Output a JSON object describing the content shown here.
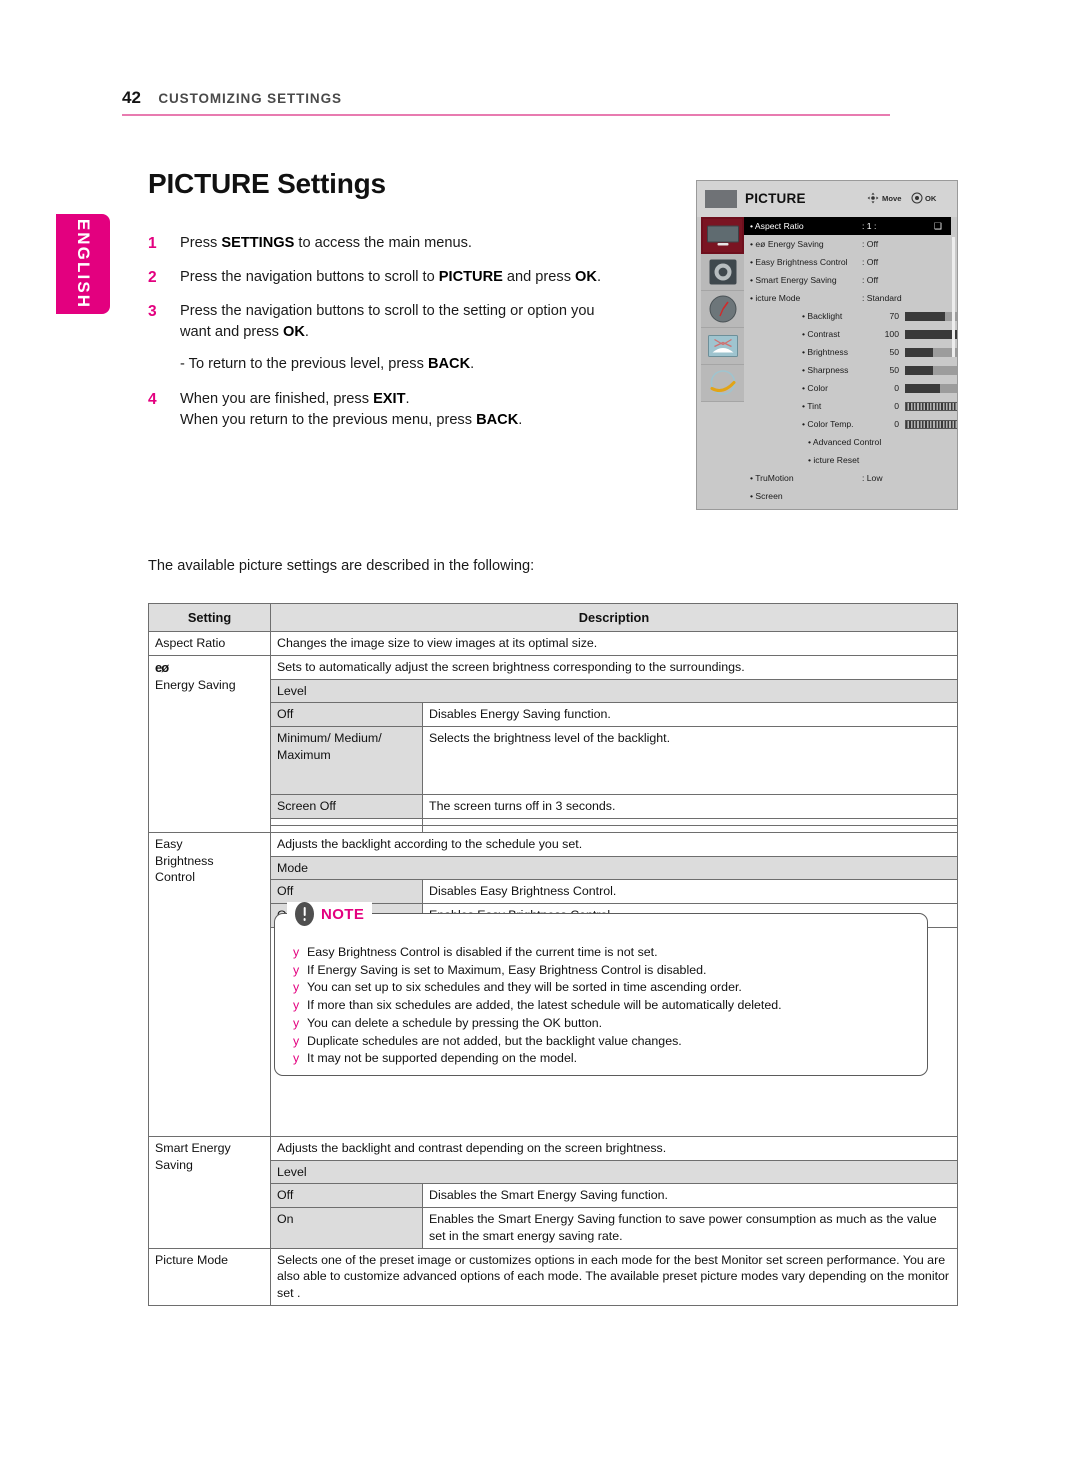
{
  "header": {
    "page_number": "42",
    "section": "CUSTOMIZING SETTINGS"
  },
  "language_tab": {
    "label": "ENGLISH"
  },
  "title": "PICTURE Settings",
  "steps": [
    {
      "num": "1",
      "html": "Press <b>SETTINGS</b> to access the main menus."
    },
    {
      "num": "2",
      "html": "Press the navigation buttons to scroll to <b>PICTURE</b> and press <b>OK</b>."
    },
    {
      "num": "3",
      "html": "Press the navigation buttons to scroll to the setting or option you want and press <b>OK</b>.",
      "sub": "- To return to the previous level, press <b>BACK</b>."
    },
    {
      "num": "4",
      "html": "When you are finished, press <b>EXIT</b>.<br>When you return to the previous menu, press <b>BACK</b>."
    }
  ],
  "intro_line": "The available picture settings are described in the following:",
  "osd": {
    "title": "PICTURE",
    "hint_move": "Move",
    "hint_ok": "OK",
    "rail_icons": [
      "monitor-icon",
      "speaker-icon",
      "clock-icon",
      "screen-icon",
      "globe-icon"
    ],
    "rows": [
      {
        "label": "• Aspect Ratio",
        "value": ": 1   :",
        "arrow": "❑",
        "highlight": true
      },
      {
        "label": "• eø Energy Saving",
        "value": ": Off"
      },
      {
        "label": "• Easy Brightness Control",
        "value": ": Off"
      },
      {
        "label": "• Smart Energy Saving",
        "value": ": Off"
      },
      {
        "label": "•    icture Mode",
        "value": ": Standard"
      }
    ],
    "sliders": [
      {
        "label": "• Backlight",
        "value": "70",
        "fill": 72,
        "style": "solid"
      },
      {
        "label": "• Contrast",
        "value": "100",
        "fill": 100,
        "style": "solid"
      },
      {
        "label": "• Brightness",
        "value": "50",
        "fill": 50,
        "style": "solid"
      },
      {
        "label": "• Sharpness",
        "value": "50",
        "fill": 50,
        "style": "solid"
      },
      {
        "label": "• Color",
        "value": "0",
        "fill": 62,
        "style": "solid"
      },
      {
        "label": "• Tint",
        "value": "0",
        "fill": 0,
        "style": "tick"
      },
      {
        "label": "• Color Temp.",
        "value": "0",
        "fill": 0,
        "style": "tick"
      }
    ],
    "tail_rows": [
      {
        "label": "• Advanced Control",
        "indent": 1
      },
      {
        "label": "•     icture Reset",
        "indent": 1
      },
      {
        "label": "• TruMotion",
        "value": ": Low",
        "indent": 0
      },
      {
        "label": "• Screen",
        "indent": 0
      }
    ]
  },
  "table": {
    "headers": {
      "setting": "Setting",
      "description": "Description"
    },
    "rows": {
      "aspect_ratio": {
        "setting": "Aspect Ratio",
        "desc": "Changes the image size to view images at its optimal size."
      },
      "energy_saving": {
        "icon": "eø",
        "setting": "Energy Saving",
        "desc": "Sets to automatically adjust the screen brightness corresponding to the surroundings.",
        "group": "Level",
        "options": [
          {
            "name": "Off",
            "desc": "Disables Energy Saving function."
          },
          {
            "name": "Minimum/\nMedium/\nMaximum",
            "desc": "Selects the brightness level of the backlight."
          },
          {
            "name": "Screen Off",
            "desc": "The screen turns off in 3 seconds."
          }
        ]
      },
      "easy_brightness": {
        "setting": "Easy\nBrightness\nControl",
        "desc": "Adjusts the backlight according to the schedule you set.",
        "group": "Mode",
        "options": [
          {
            "name": "Off",
            "desc": "Disables Easy Brightness Control."
          },
          {
            "name": "On",
            "desc": "Enables Easy Brightness Control."
          }
        ]
      },
      "smart_energy": {
        "setting": "Smart Energy\nSaving",
        "desc": "Adjusts the backlight and contrast depending on the screen brightness.",
        "group": "Level",
        "options": [
          {
            "name": "Off",
            "desc": "Disables the Smart Energy Saving function."
          },
          {
            "name": "On",
            "desc": "Enables the Smart Energy Saving function to save power consumption as much as the value set in the smart energy saving rate."
          }
        ]
      },
      "picture_mode": {
        "setting": "Picture Mode",
        "desc": "Selects one of the preset image or customizes options in each mode for the best Monitor set screen performance. You are also able to customize advanced options of each mode. The available preset picture modes vary depending on the monitor set ."
      }
    }
  },
  "note": {
    "label": "NOTE",
    "items": [
      "Easy Brightness Control is disabled if the current time is not set.",
      "If Energy Saving is set to Maximum, Easy Brightness Control is disabled.",
      "You can set up to six schedules and they will be sorted in time ascending order.",
      "If more than six schedules are added, the latest schedule will be automatically deleted.",
      "You can delete a schedule by pressing the OK button.",
      "Duplicate schedules are not added, but the backlight value changes.",
      "It may not be supported depending on the model."
    ],
    "bullet": "y"
  },
  "colors": {
    "accent": "#e3007f",
    "rule": "#e87bb0",
    "table_header_bg": "#dedede"
  }
}
